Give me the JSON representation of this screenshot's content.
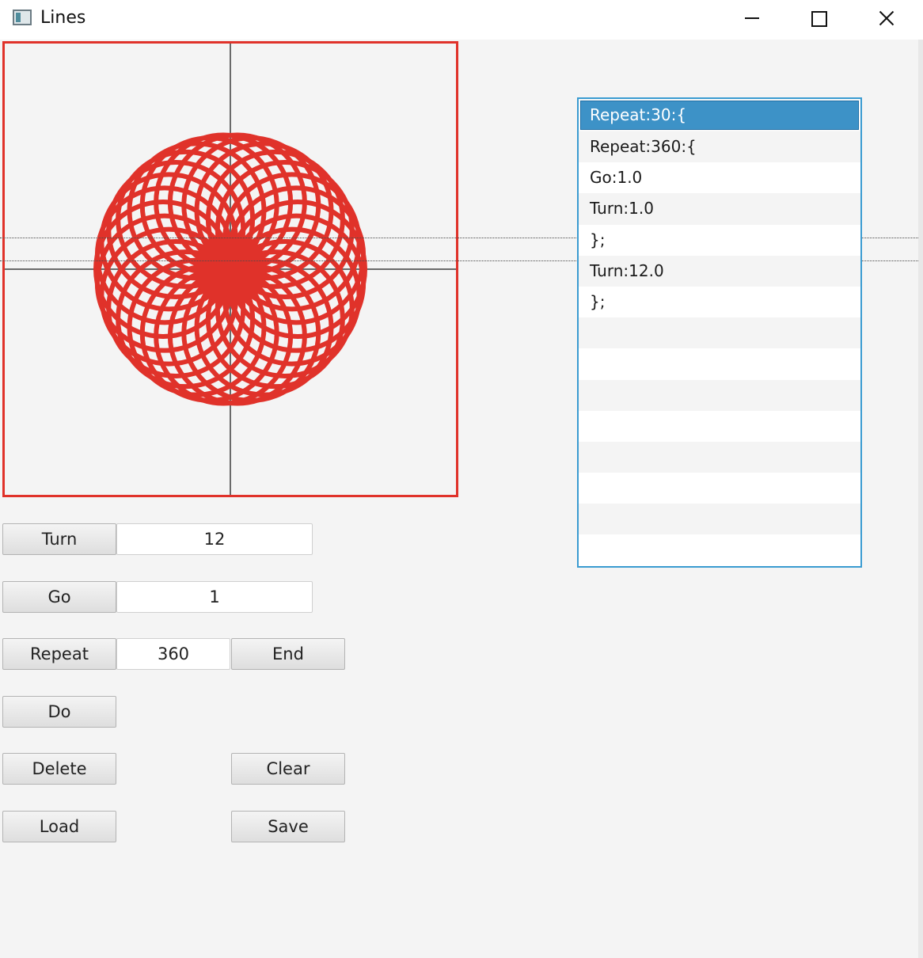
{
  "window": {
    "title": "Lines"
  },
  "canvas": {
    "accent": "#e0322a",
    "drawing": "rosette of 30 circles"
  },
  "command_list": {
    "items": [
      {
        "label": "Repeat:30:{",
        "selected": true
      },
      {
        "label": "Repeat:360:{",
        "selected": false
      },
      {
        "label": "Go:1.0",
        "selected": false
      },
      {
        "label": "Turn:1.0",
        "selected": false
      },
      {
        "label": "};",
        "selected": false
      },
      {
        "label": "Turn:12.0",
        "selected": false
      },
      {
        "label": "};",
        "selected": false
      }
    ]
  },
  "controls": {
    "turn_label": "Turn",
    "turn_value": "12",
    "go_label": "Go",
    "go_value": "1",
    "repeat_label": "Repeat",
    "repeat_value": "360",
    "end_label": "End",
    "do_label": "Do",
    "delete_label": "Delete",
    "clear_label": "Clear",
    "load_label": "Load",
    "save_label": "Save"
  }
}
